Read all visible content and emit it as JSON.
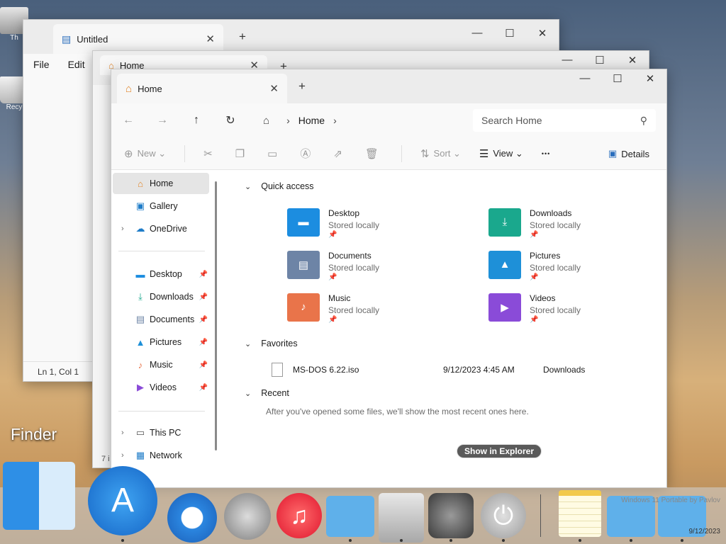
{
  "desktop": {
    "icon1_label": "Th",
    "icon2_label": "Recy",
    "finder_label": "Finder"
  },
  "notepad": {
    "tab_title": "Untitled",
    "menu": [
      "File",
      "Edit"
    ],
    "status": "Ln 1, Col 1"
  },
  "explorer_back": {
    "tab_title": "Home",
    "status": "7 i"
  },
  "explorer": {
    "tab_title": "Home",
    "breadcrumb": "Home",
    "search_placeholder": "Search Home",
    "toolbar": {
      "new": "New",
      "sort": "Sort",
      "view": "View",
      "more": "•••",
      "details": "Details"
    },
    "sidebar": {
      "home": "Home",
      "gallery": "Gallery",
      "onedrive": "OneDrive",
      "pinned": [
        "Desktop",
        "Downloads",
        "Documents",
        "Pictures",
        "Music",
        "Videos"
      ],
      "this_pc": "This PC",
      "network": "Network"
    },
    "quick_access": {
      "heading": "Quick access",
      "items": [
        {
          "name": "Desktop",
          "status": "Stored locally",
          "icon": "desktop-folder-icon",
          "color": "#1c8de0"
        },
        {
          "name": "Downloads",
          "status": "Stored locally",
          "icon": "downloads-folder-icon",
          "color": "#1aa88d"
        },
        {
          "name": "Documents",
          "status": "Stored locally",
          "icon": "documents-folder-icon",
          "color": "#6d84a6"
        },
        {
          "name": "Pictures",
          "status": "Stored locally",
          "icon": "pictures-folder-icon",
          "color": "#1e90d8"
        },
        {
          "name": "Music",
          "status": "Stored locally",
          "icon": "music-folder-icon",
          "color": "#e9744a"
        },
        {
          "name": "Videos",
          "status": "Stored locally",
          "icon": "videos-folder-icon",
          "color": "#8a4bd8"
        }
      ]
    },
    "favorites": {
      "heading": "Favorites",
      "file_name": "MS-DOS 6.22.iso",
      "file_date": "9/12/2023 4:45 AM",
      "file_location": "Downloads"
    },
    "recent": {
      "heading": "Recent",
      "message": "After you've opened some files, we'll show the most recent ones here."
    }
  },
  "tooltip": "Show in Explorer",
  "dock": {
    "items": [
      "finder-icon",
      "app-store-icon",
      "safari-icon",
      "launchpad-icon",
      "music-icon",
      "library-folder-icon",
      "mac-pro-icon",
      "system-preferences-icon",
      "power-icon",
      "notes-icon",
      "window-folder-icon",
      "documents-folder-icon"
    ],
    "tray_line1": "Windows 11 Portable by Pavlov",
    "tray_date": "9/12/2023"
  }
}
